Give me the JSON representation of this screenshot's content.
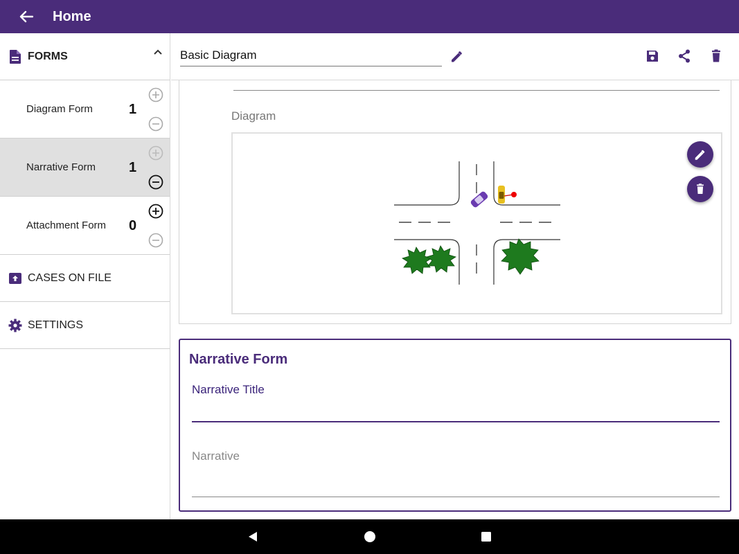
{
  "appbar": {
    "title": "Home"
  },
  "sidebar": {
    "forms_label": "FORMS",
    "forms": [
      {
        "name": "Diagram Form",
        "count": "1"
      },
      {
        "name": "Narrative Form",
        "count": "1"
      },
      {
        "name": "Attachment Form",
        "count": "0"
      }
    ],
    "cases_label": "CASES ON FILE",
    "settings_label": "SETTINGS"
  },
  "toolbar": {
    "document_name": "Basic Diagram"
  },
  "diagram": {
    "label": "Diagram"
  },
  "narrative": {
    "heading": "Narrative Form",
    "title_label": "Narrative Title",
    "narrative_label": "Narrative"
  },
  "colors": {
    "primary": "#4a2c7a",
    "tree_green": "#1e7a1e"
  }
}
